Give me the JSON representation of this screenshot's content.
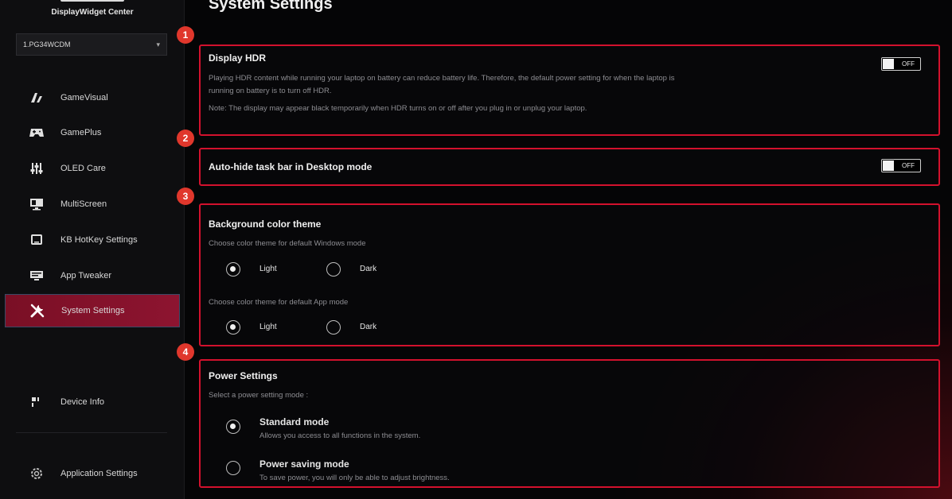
{
  "app": {
    "name": "DisplayWidget Center"
  },
  "monitor": {
    "selected": "1.PG34WCDM"
  },
  "sidebar": {
    "items": [
      {
        "label": "GameVisual",
        "icon": "gamevisual-icon"
      },
      {
        "label": "GamePlus",
        "icon": "gamepad-icon"
      },
      {
        "label": "OLED Care",
        "icon": "sliders-icon"
      },
      {
        "label": "MultiScreen",
        "icon": "multiscreen-icon"
      },
      {
        "label": "KB HotKey Settings",
        "icon": "keyboard-icon"
      },
      {
        "label": "App Tweaker",
        "icon": "app-tweaker-icon"
      },
      {
        "label": "System Settings",
        "icon": "tools-icon",
        "active": true
      }
    ],
    "bottom": [
      {
        "label": "Device Info",
        "icon": "device-info-icon"
      },
      {
        "label": "Application Settings",
        "icon": "gear-icon"
      }
    ]
  },
  "page": {
    "title": "System Settings"
  },
  "badges": [
    "1",
    "2",
    "3",
    "4"
  ],
  "hdr": {
    "title": "Display HDR",
    "desc1": "Playing HDR content while running your laptop on battery can reduce battery life. Therefore, the default power setting for when the laptop is",
    "desc2": "running on battery is to turn off HDR.",
    "note": "Note: The display may appear black temporarily when HDR turns on or off after you plug in or unplug your laptop.",
    "toggle": "OFF"
  },
  "taskbar": {
    "title": "Auto-hide task bar in Desktop mode",
    "toggle": "OFF"
  },
  "theme": {
    "title": "Background color theme",
    "windows_label": "Choose color theme for default Windows mode",
    "app_label": "Choose color theme for default App mode",
    "light": "Light",
    "dark": "Dark",
    "windows_selected": "Light",
    "app_selected": "Light"
  },
  "power": {
    "title": "Power Settings",
    "subtitle": "Select a power setting mode :",
    "standard": {
      "label": "Standard mode",
      "desc": "Allows you access to all functions in the system."
    },
    "saving": {
      "label": "Power saving mode",
      "desc": "To save power, you will only be able to adjust brightness."
    },
    "selected": "Standard mode"
  },
  "colors": {
    "accent": "#d3112d",
    "active_nav": "#8d1430",
    "badge": "#e0372c"
  }
}
